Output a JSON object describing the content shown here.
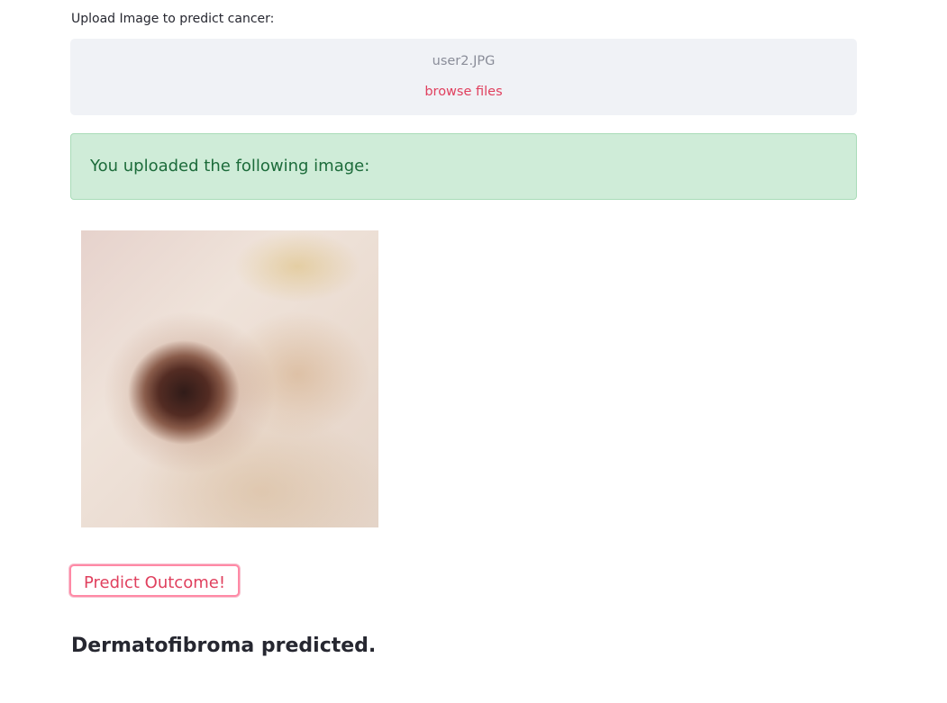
{
  "uploader": {
    "label": "Upload Image to predict cancer:",
    "filename": "user2.JPG",
    "browse_label": "browse files"
  },
  "alert": {
    "message": "You uploaded the following image:"
  },
  "image": {
    "alt": "uploaded skin lesion image"
  },
  "actions": {
    "predict_label": "Predict Outcome!"
  },
  "result": {
    "text": "Dermatofibroma predicted."
  },
  "colors": {
    "accent": "#e0405e",
    "success_bg": "#cfecd8",
    "success_text": "#1c6b3a",
    "dropzone_bg": "#f0f2f6"
  }
}
